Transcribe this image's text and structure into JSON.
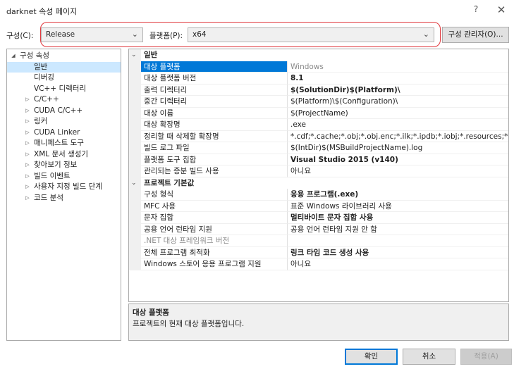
{
  "window": {
    "title": "darknet 속성 페이지",
    "help_glyph": "?",
    "close_glyph": "✕"
  },
  "config": {
    "label": "구성(C):",
    "value": "Release"
  },
  "platform": {
    "label": "플랫폼(P):",
    "value": "x64"
  },
  "config_manager_label": "구성 관리자(O)...",
  "tree": [
    {
      "label": "구성 속성",
      "level": 0,
      "arrow": "expanded"
    },
    {
      "label": "일반",
      "level": 1,
      "arrow": "none",
      "selected": true
    },
    {
      "label": "디버깅",
      "level": 1,
      "arrow": "none"
    },
    {
      "label": "VC++ 디렉터리",
      "level": 1,
      "arrow": "none"
    },
    {
      "label": "C/C++",
      "level": 1,
      "arrow": "collapsed"
    },
    {
      "label": "CUDA C/C++",
      "level": 1,
      "arrow": "collapsed"
    },
    {
      "label": "링커",
      "level": 1,
      "arrow": "collapsed"
    },
    {
      "label": "CUDA Linker",
      "level": 1,
      "arrow": "collapsed"
    },
    {
      "label": "매니페스트 도구",
      "level": 1,
      "arrow": "collapsed"
    },
    {
      "label": "XML 문서 생성기",
      "level": 1,
      "arrow": "collapsed"
    },
    {
      "label": "찾아보기 정보",
      "level": 1,
      "arrow": "collapsed"
    },
    {
      "label": "빌드 이벤트",
      "level": 1,
      "arrow": "collapsed"
    },
    {
      "label": "사용자 지정 빌드 단계",
      "level": 1,
      "arrow": "collapsed"
    },
    {
      "label": "코드 분석",
      "level": 1,
      "arrow": "collapsed"
    }
  ],
  "grid": [
    {
      "type": "category",
      "label": "일반"
    },
    {
      "type": "prop",
      "name": "대상 플랫폼",
      "value": "Windows",
      "selected": true,
      "gray": true
    },
    {
      "type": "prop",
      "name": "대상 플랫폼 버전",
      "value": "8.1",
      "bold": true
    },
    {
      "type": "prop",
      "name": "출력 디렉터리",
      "value": "$(SolutionDir)$(Platform)\\",
      "bold": true
    },
    {
      "type": "prop",
      "name": "중간 디렉터리",
      "value": "$(Platform)\\$(Configuration)\\"
    },
    {
      "type": "prop",
      "name": "대상 이름",
      "value": "$(ProjectName)"
    },
    {
      "type": "prop",
      "name": "대상 확장명",
      "value": ".exe"
    },
    {
      "type": "prop",
      "name": "정리할 때 삭제할 확장명",
      "value": "*.cdf;*.cache;*.obj;*.obj.enc;*.ilk;*.ipdb;*.iobj;*.resources;*.tlb;*.tli;*.tl"
    },
    {
      "type": "prop",
      "name": "빌드 로그 파일",
      "value": "$(IntDir)$(MSBuildProjectName).log"
    },
    {
      "type": "prop",
      "name": "플랫폼 도구 집합",
      "value": "Visual Studio 2015 (v140)",
      "bold": true
    },
    {
      "type": "prop",
      "name": "관리되는 증분 빌드 사용",
      "value": "아니요"
    },
    {
      "type": "category",
      "label": "프로젝트 기본값"
    },
    {
      "type": "prop",
      "name": "구성 형식",
      "value": "응용 프로그램(.exe)",
      "bold": true
    },
    {
      "type": "prop",
      "name": "MFC 사용",
      "value": "표준 Windows 라이브러리 사용"
    },
    {
      "type": "prop",
      "name": "문자 집합",
      "value": "멀티바이트 문자 집합 사용",
      "bold": true
    },
    {
      "type": "prop",
      "name": "공용 언어 런타임 지원",
      "value": "공용 언어 런타임 지원 안 함"
    },
    {
      "type": "prop",
      "name": ".NET 대상 프레임워크 버전",
      "value": "",
      "gray_name": true
    },
    {
      "type": "prop",
      "name": "전체 프로그램 최적화",
      "value": "링크 타임 코드 생성 사용",
      "bold": true
    },
    {
      "type": "prop",
      "name": "Windows 스토어 응용 프로그램 지원",
      "value": "아니요"
    }
  ],
  "description": {
    "title": "대상 플랫폼",
    "text": "프로젝트의 현재 대상 플랫폼입니다."
  },
  "buttons": {
    "ok": "확인",
    "cancel": "취소",
    "apply": "적용(A)"
  }
}
